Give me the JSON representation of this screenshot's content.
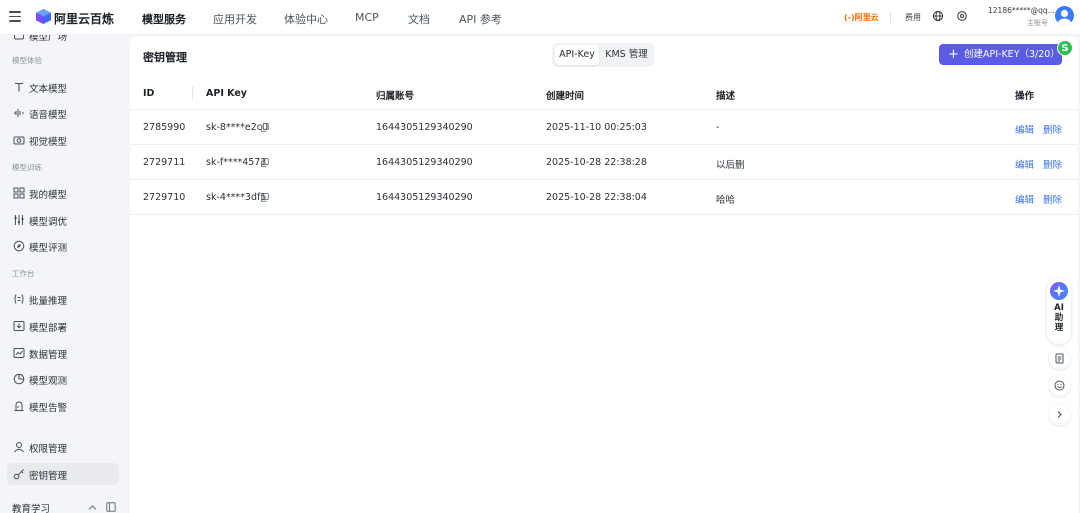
{
  "brand": {
    "name": "阿里云百炼"
  },
  "nav": [
    "模型服务",
    "应用开发",
    "体验中心",
    "MCP",
    "文档",
    "API 参考"
  ],
  "topbar": {
    "aliyun": "(-)阿里云",
    "fee": "费用",
    "account": "12186*****@qq....",
    "account_sub": "主账号"
  },
  "sidebar": {
    "partial_item": "模型广场",
    "groups": [
      "模型体验",
      "模型训练",
      "工作台"
    ],
    "items": [
      {
        "label": "文本模型",
        "icon": "text-icon"
      },
      {
        "label": "语音模型",
        "icon": "audio-wave-icon"
      },
      {
        "label": "视觉模型",
        "icon": "camera-icon"
      },
      {
        "label": "我的模型",
        "icon": "model-grid-icon"
      },
      {
        "label": "模型调优",
        "icon": "tune-icon"
      },
      {
        "label": "模型评测",
        "icon": "compass-icon"
      },
      {
        "label": "批量推理",
        "icon": "batch-icon"
      },
      {
        "label": "模型部署",
        "icon": "deploy-icon"
      },
      {
        "label": "数据管理",
        "icon": "chart-icon"
      },
      {
        "label": "模型观测",
        "icon": "pie-icon"
      },
      {
        "label": "模型告警",
        "icon": "alarm-icon"
      },
      {
        "label": "权限管理",
        "icon": "user-icon"
      },
      {
        "label": "密钥管理",
        "icon": "key-icon",
        "active": true
      }
    ],
    "bottom": "教育学习"
  },
  "page": {
    "title": "密钥管理",
    "tabs": [
      "API-Key",
      "KMS 管理"
    ],
    "active_tab": 0,
    "create_button": "创建API-KEY（3/20）",
    "badge": "S"
  },
  "table": {
    "columns": [
      "ID",
      "API Key",
      "归属账号",
      "创建时间",
      "描述",
      "操作"
    ],
    "rows": [
      {
        "id": "2785990",
        "key": "sk-8****e2c0",
        "account": "1644305129340290",
        "created": "2025-11-10 00:25:03",
        "desc": "-"
      },
      {
        "id": "2729711",
        "key": "sk-f****4573",
        "account": "1644305129340290",
        "created": "2025-10-28 22:38:28",
        "desc": "以后删"
      },
      {
        "id": "2729710",
        "key": "sk-4****3df5",
        "account": "1644305129340290",
        "created": "2025-10-28 22:38:04",
        "desc": "哈哈"
      }
    ],
    "actions": [
      "编辑",
      "删除"
    ]
  },
  "assistant": {
    "label": "AI\n助\n理"
  },
  "colors": {
    "primary": "#5b5ce6",
    "link": "#3a72f3",
    "orange": "#ff6a00"
  }
}
